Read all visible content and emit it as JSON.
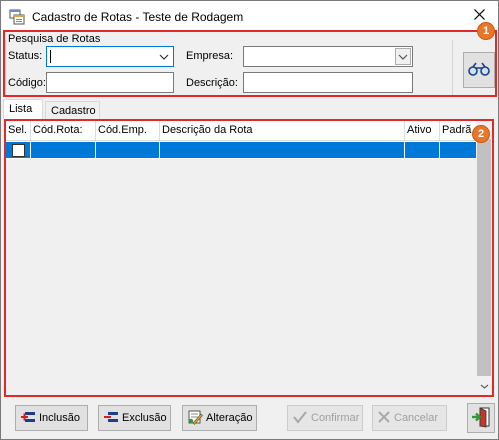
{
  "window": {
    "title": "Cadastro de Rotas - Teste de Rodagem"
  },
  "filters": {
    "group_label": "Pesquisa de Rotas",
    "status_label": "Status:",
    "status_value": "",
    "empresa_label": "Empresa:",
    "empresa_value": "",
    "codigo_label": "Código:",
    "codigo_value": "",
    "descricao_label": "Descrição:",
    "descricao_value": ""
  },
  "tabs": [
    {
      "label": "Lista",
      "active": true
    },
    {
      "label": "Cadastro",
      "active": false
    }
  ],
  "grid": {
    "columns": [
      "Sel.",
      "Cód.Rota:",
      "Cód.Emp.",
      "Descrição da Rota",
      "Ativo",
      "Padrã"
    ],
    "rows": [
      {
        "sel": false,
        "cod_rota": "",
        "cod_emp": "",
        "descricao": "",
        "ativo": "",
        "padrao": ""
      }
    ]
  },
  "markers": [
    "1",
    "2"
  ],
  "buttons": {
    "inclusao": "Inclusão",
    "exclusao": "Exclusão",
    "alteracao": "Alteração",
    "confirmar": "Confirmar",
    "cancelar": "Cancelar"
  },
  "icons": {
    "app": "app-window-icon",
    "close": "close-icon",
    "search": "binoculars-icon",
    "exit": "exit-door-icon"
  },
  "colors": {
    "selection": "#0078d7",
    "highlight": "#e02a2a",
    "marker": "#e8772a"
  }
}
